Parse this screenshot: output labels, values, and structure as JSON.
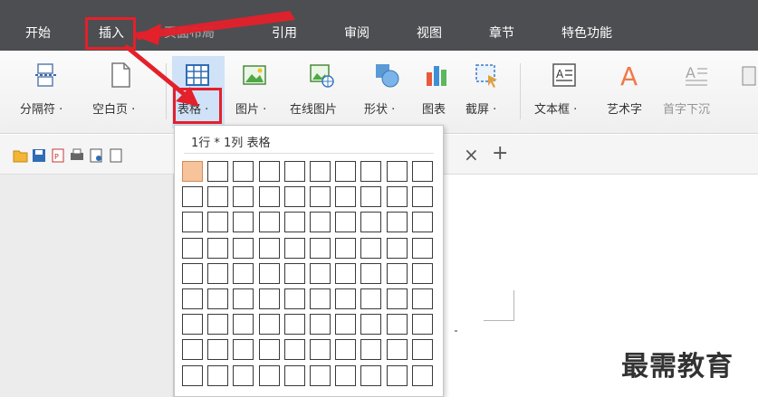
{
  "menu": {
    "tabs": [
      "开始",
      "插入",
      "页面布局",
      "引用",
      "审阅",
      "视图",
      "章节",
      "特色功能"
    ],
    "active_index": 1
  },
  "ribbon": {
    "page_break": "分隔符 ·",
    "blank_page": "空白页 ·",
    "table": "表格 ·",
    "picture": "图片 ·",
    "online_picture": "在线图片",
    "shapes": "形状 ·",
    "chart": "图表",
    "screenshot": "截屏 ·",
    "text_box": "文本框 ·",
    "word_art": "艺术字",
    "drop_cap": "首字下沉"
  },
  "doc_tabs": {
    "close": "×",
    "add": "+"
  },
  "table_dropdown": {
    "title": "1行 * 1列 表格",
    "rows": 9,
    "cols": 10,
    "selected_rows": 1,
    "selected_cols": 1
  },
  "watermark": "最需教育",
  "colors": {
    "menubar": "#4d4e51",
    "highlight": "#e4202b",
    "selected_cell": "#f6c39a"
  }
}
